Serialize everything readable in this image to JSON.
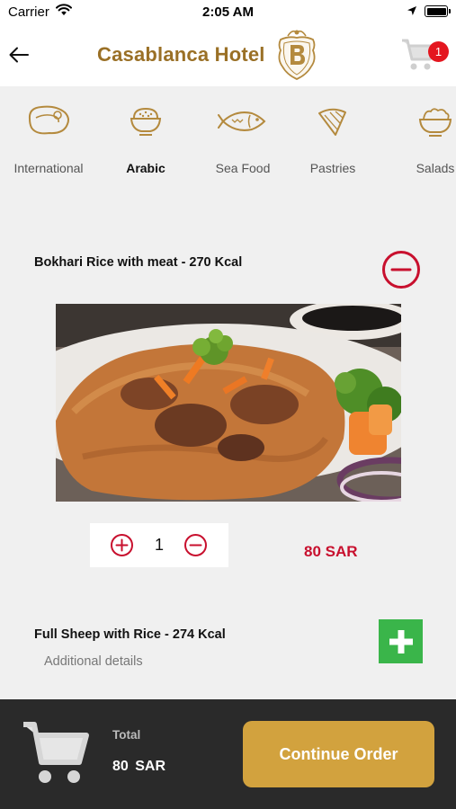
{
  "status_bar": {
    "carrier": "Carrier",
    "time": "2:05 AM"
  },
  "header": {
    "title": "Casablanca Hotel",
    "cart_count": "1"
  },
  "categories": [
    {
      "label": "International",
      "icon": "steak-icon",
      "active": false
    },
    {
      "label": "Arabic",
      "icon": "rice-bowl-icon",
      "active": true
    },
    {
      "label": "Sea Food",
      "icon": "fish-icon",
      "active": false
    },
    {
      "label": "Pastries",
      "icon": "pastry-icon",
      "active": false
    },
    {
      "label": "Salads",
      "icon": "salad-bowl-icon",
      "active": false
    }
  ],
  "items": [
    {
      "title": "Bokhari Rice with meat - 270 Kcal",
      "quantity": "1",
      "price": "80 SAR",
      "in_cart": true
    },
    {
      "title": "Full Sheep with Rice - 274 Kcal",
      "details": "Additional details",
      "in_cart": false
    }
  ],
  "footer": {
    "total_label": "Total",
    "total_value": "80  SAR",
    "continue_label": "Continue Order"
  },
  "colors": {
    "gold": "#9a7026",
    "button_gold": "#d2a23e",
    "red": "#c8102e",
    "green": "#3ab54a",
    "footer": "#2a2a2a",
    "badge": "#e4161f"
  }
}
